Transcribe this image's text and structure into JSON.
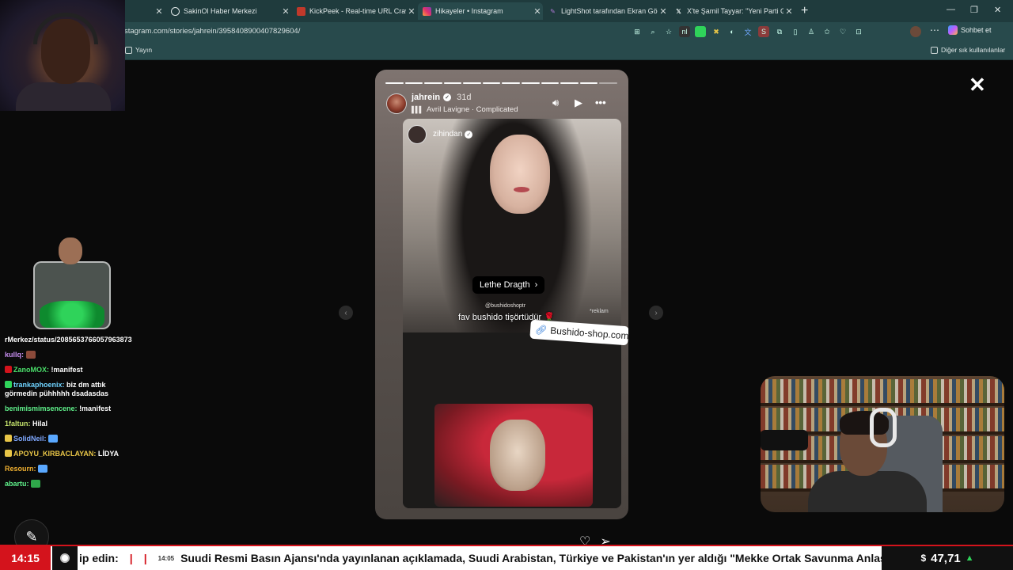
{
  "browser": {
    "tabs": [
      {
        "title": "",
        "color": "#2a2f3a"
      },
      {
        "title": "SakinOl Haber Merkezi",
        "color": "#dfe7e7"
      },
      {
        "title": "KickPeek - Real-time URL Crawler",
        "color": "#c0392b"
      },
      {
        "title": "Hikayeler • Instagram",
        "color": "#e1306c"
      },
      {
        "title": "LightShot tarafından Ekran Görünt",
        "color": "#8e44ad"
      },
      {
        "title": "X'te Şamil Tayyar: \"Yeni Parti Genel",
        "color": "#000000"
      }
    ],
    "url": "stagram.com/stories/jahrein/3958408900407829604/",
    "copilot_label": "Sohbet et",
    "bookmarks": {
      "left": "Yayın",
      "right": "Diğer sık kullanılanlar"
    }
  },
  "story": {
    "username": "jahrein",
    "age": "31d",
    "music": "Avril Lavigne · Complicated",
    "inner_username": "zihindan",
    "mention": "Lethe Dragth",
    "watermark": "@bushidoshoptr",
    "caption": "fav bushido tişörtüdür 🌹",
    "ad_label": "*reklam",
    "link_text": "Bushido-shop.com"
  },
  "chat": {
    "partial_link": "rMerkez/status/2085653766057963873",
    "messages": [
      {
        "user": "kullq:",
        "text": "",
        "color": "#c78ef0",
        "emote": "#8b4a3a"
      },
      {
        "user": "ZanoMOX:",
        "text": "!manifest",
        "color": "#4be06b",
        "badge": "#d4131c"
      },
      {
        "user": "trankaphoenix:",
        "text": "biz dm attık görmedin pühhhhh dsadasdas",
        "color": "#6fd3ff",
        "badge": "#2fd35a"
      },
      {
        "user": "benimismimsencene:",
        "text": "!manifest",
        "color": "#5ff08a"
      },
      {
        "user": "1faltun:",
        "text": "Hilal",
        "color": "#c2e06b"
      },
      {
        "user": "SolidNeil:",
        "text": "",
        "color": "#7fa8ff",
        "badge": "#e8c547",
        "emote": "#5aa8ff"
      },
      {
        "user": "APOYU_KIRBACLAYAN:",
        "text": "LİDYA",
        "color": "#e8c547",
        "badge": "#e8c547"
      },
      {
        "user": "Resourn:",
        "text": "",
        "color": "#f0b030",
        "emote": "#5aa8ff"
      },
      {
        "user": "abartu:",
        "text": "",
        "color": "#5ff08a",
        "emote": "#2fa84a"
      }
    ]
  },
  "ticker": {
    "clock": "14:15",
    "lead": "ip edin:",
    "time": "14:05",
    "headline": "Suudi Resmi Basın Ajansı'nda yayınlanan açıklamada, Suudi Arabistan, Türkiye ve Pakistan'ın yer aldığı \"Mekke Ortak Savunma Anlaşması",
    "currency_symbol": "$",
    "currency_value": "47,71",
    "trend": "up"
  },
  "colors": {
    "accent": "#d4131c",
    "chrome": "#284a4c",
    "tabbar": "#1f3b3d"
  }
}
